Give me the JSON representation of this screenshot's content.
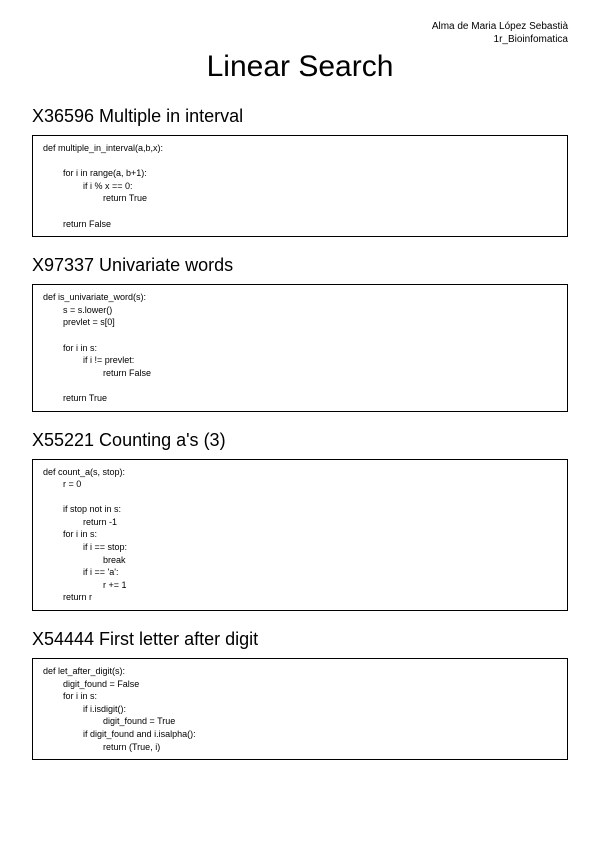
{
  "meta": {
    "author": "Alma de Maria López Sebastià",
    "course": "1r_Bioinfomatica"
  },
  "title": "Linear Search",
  "sections": [
    {
      "heading": "X36596   Multiple in interval",
      "code": "def multiple_in_interval(a,b,x):\n\n        for i in range(a, b+1):\n                if i % x == 0:\n                        return True\n\n        return False"
    },
    {
      "heading": "X97337   Univariate words",
      "code": "def is_univariate_word(s):\n        s = s.lower()\n        prevlet = s[0]\n\n        for i in s:\n                if i != prevlet:\n                        return False\n\n        return True"
    },
    {
      "heading": "X55221   Counting a's (3)",
      "code": "def count_a(s, stop):\n        r = 0\n\n        if stop not in s:\n                return -1\n        for i in s:\n                if i == stop:\n                        break\n                if i == 'a':\n                        r += 1\n        return r"
    },
    {
      "heading": "X54444   First letter after digit",
      "code": "def let_after_digit(s):\n        digit_found = False\n        for i in s:\n                if i.isdigit():\n                        digit_found = True\n                if digit_found and i.isalpha():\n                        return (True, i)"
    }
  ]
}
